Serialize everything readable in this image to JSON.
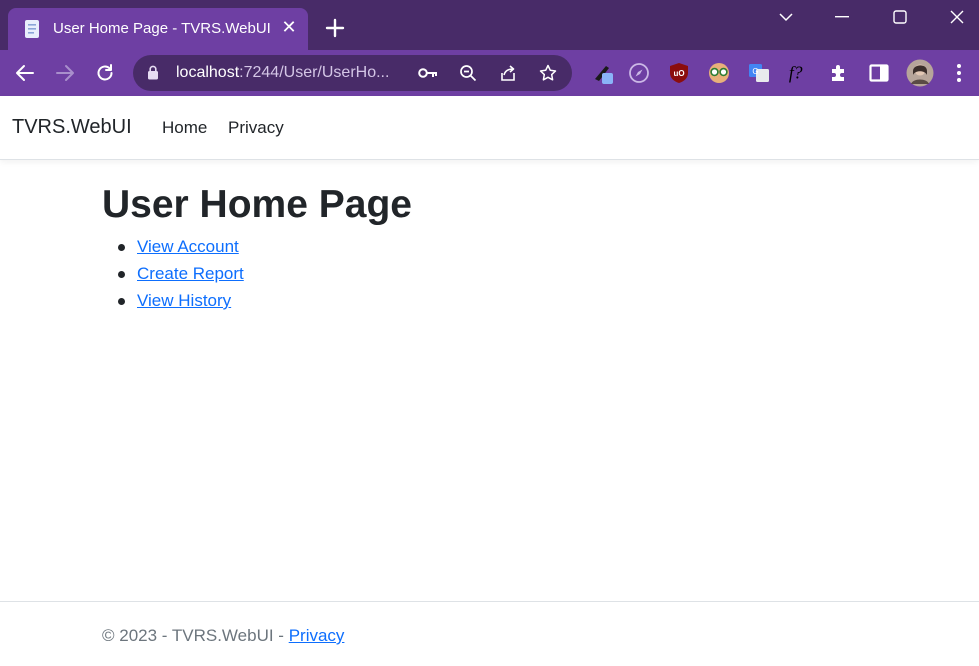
{
  "browser": {
    "tab_title": "User Home Page - TVRS.WebUI",
    "url_host": "localhost",
    "url_path": ":7244/User/UserHo..."
  },
  "site": {
    "brand": "TVRS.WebUI",
    "nav": {
      "home": "Home",
      "privacy": "Privacy"
    }
  },
  "main": {
    "title": "User Home Page",
    "links": [
      "View Account",
      "Create Report",
      "View History"
    ]
  },
  "footer": {
    "copyright": "© 2023 - TVRS.WebUI - ",
    "privacy_link": "Privacy"
  },
  "theme": {
    "chrome_dark": "#482b68",
    "chrome_light": "#6e3fa3",
    "link": "#0d6efd"
  }
}
